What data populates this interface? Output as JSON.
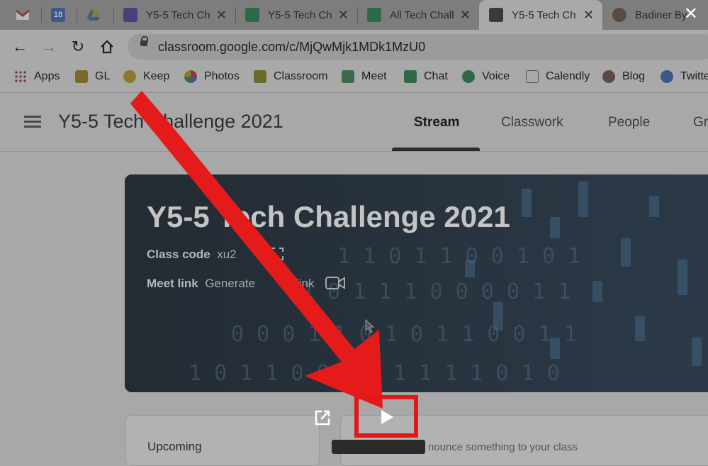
{
  "browser": {
    "tabs": [
      {
        "title": "",
        "icon": "gmail-icon"
      },
      {
        "title": "",
        "icon": "calendar-icon",
        "badge": "18"
      },
      {
        "title": "",
        "icon": "drive-icon"
      },
      {
        "title": "Y5-5 Tech Ch",
        "icon": "forms-icon"
      },
      {
        "title": "Y5-5 Tech Ch",
        "icon": "sheets-icon"
      },
      {
        "title": "All Tech Chall",
        "icon": "sheets-icon"
      },
      {
        "title": "Y5-5 Tech Ch",
        "icon": "classroom-icon",
        "active": true
      },
      {
        "title": "Badiner By",
        "icon": "profile-icon"
      }
    ],
    "close_label": "✕",
    "url": "classroom.google.com/c/MjQwMjk1MDk1MzU0",
    "bookmarks": [
      "Apps",
      "GL",
      "Keep",
      "Photos",
      "Classroom",
      "Meet",
      "Chat",
      "Voice",
      "Calendly",
      "Blog",
      "Twitte"
    ]
  },
  "app": {
    "course_title": "Y5-5 Tech Challenge 2021",
    "tabs": [
      "Stream",
      "Classwork",
      "People",
      "Gr"
    ],
    "active_tab": "Stream"
  },
  "banner": {
    "title": "Y5-5 Tech Challenge 2021",
    "class_code_label": "Class code",
    "class_code_value": "xu2",
    "meet_link_label": "Meet link",
    "meet_link_value": "Generate",
    "meet_link_suffix": "link"
  },
  "cards": {
    "upcoming_label": "Upcoming",
    "announce_placeholder": "nounce something to your class"
  },
  "colors": {
    "annotation_red": "#e21717"
  }
}
